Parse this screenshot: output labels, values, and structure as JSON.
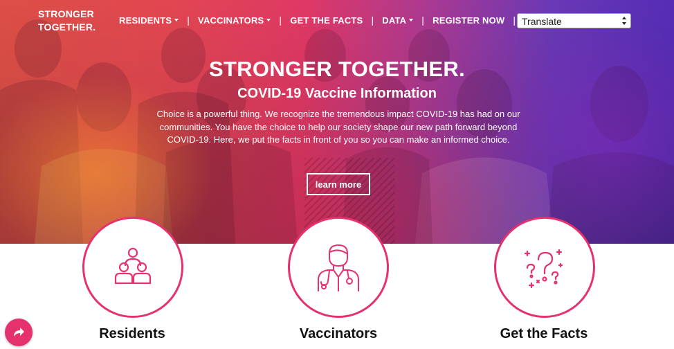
{
  "brand": {
    "line1": "STRONGER",
    "line2": "TOGETHER."
  },
  "nav": {
    "items": [
      {
        "label": "RESIDENTS",
        "dropdown": true
      },
      {
        "label": "VACCINATORS",
        "dropdown": true
      },
      {
        "label": "GET THE FACTS",
        "dropdown": false
      },
      {
        "label": "DATA",
        "dropdown": true
      },
      {
        "label": "REGISTER NOW",
        "dropdown": false
      }
    ],
    "separator": "|",
    "translate": {
      "selected": "Translate"
    }
  },
  "hero": {
    "title": "STRONGER TOGETHER.",
    "subtitle": "COVID-19 Vaccine Information",
    "body": "Choice is a powerful thing. We recognize the tremendous impact COVID-19 has had on our communities. You have the choice to help our society shape our new path forward beyond COVID-19. Here, we put the facts in front of you so you can make an informed choice.",
    "cta": "learn more"
  },
  "cards": [
    {
      "title": "Residents",
      "icon": "residents-group-icon"
    },
    {
      "title": "Vaccinators",
      "icon": "doctor-icon"
    },
    {
      "title": "Get the Facts",
      "icon": "question-marks-icon"
    }
  ],
  "colors": {
    "accent": "#e5326d",
    "hero_start": "#e8534a",
    "hero_end": "#5a2fbf",
    "text_dark": "#111111"
  },
  "share_button": {
    "icon": "share-arrow-icon"
  }
}
